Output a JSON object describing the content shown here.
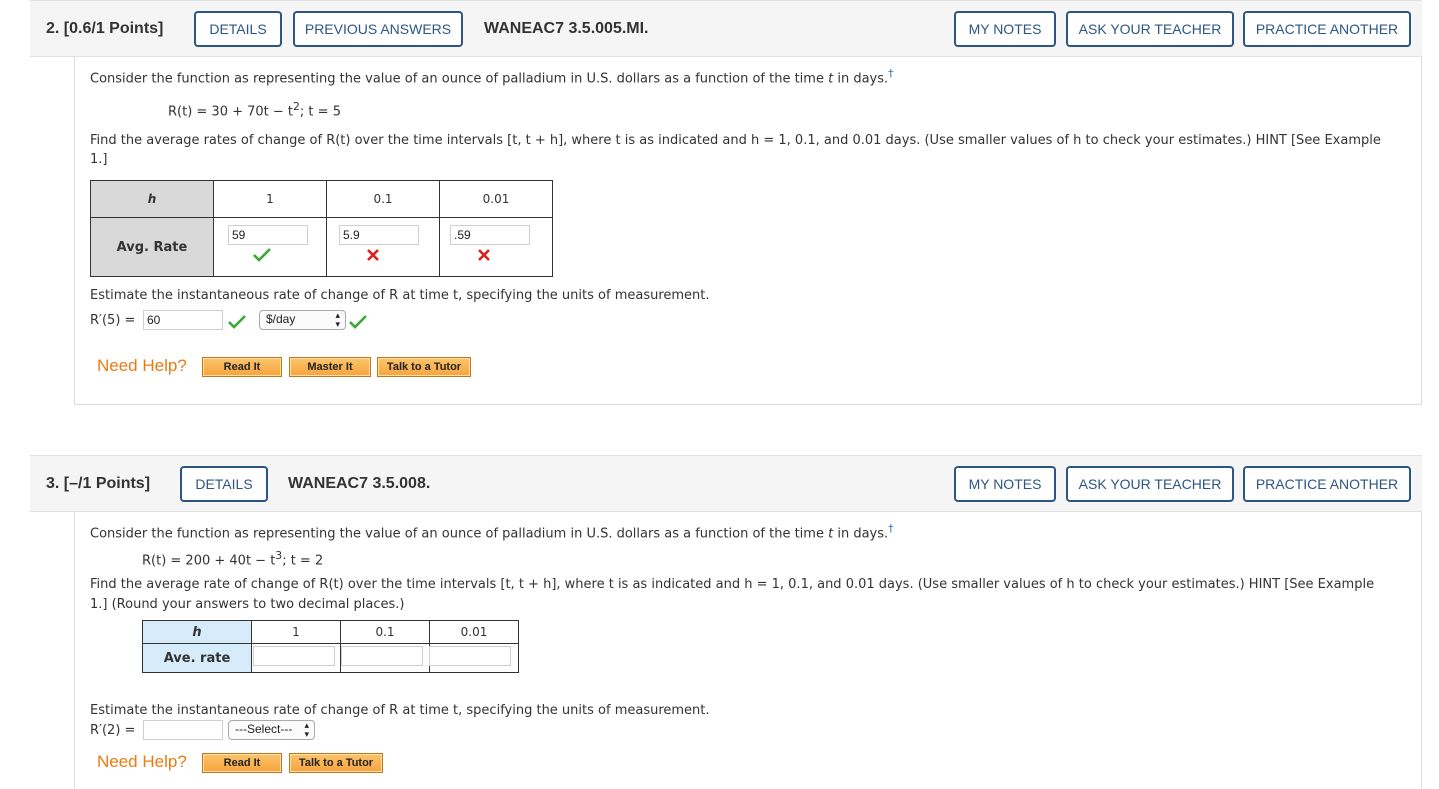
{
  "q2": {
    "number": "2.",
    "points": "[0.6/1 Points]",
    "details": "DETAILS",
    "previous_answers": "PREVIOUS ANSWERS",
    "code": "WANEAC7 3.5.005.MI.",
    "my_notes": "MY NOTES",
    "ask_teacher": "ASK YOUR TEACHER",
    "practice": "PRACTICE ANOTHER",
    "intro": "Consider the function as representing the value of an ounce of palladium in U.S. dollars as a function of the time ",
    "intro_var": "t",
    "intro_end": " in days.",
    "dagger": "†",
    "formula_a": "R(t) = 30 + 70t − t",
    "formula_exp": "2",
    "formula_b": "; t = 5",
    "find_line1": "Find the average rates of change of R(t) over the time intervals [t, t + h], where t is as indicated and h = 1, 0.1, and 0.01 days. (Use smaller values of h to check your estimates.) HINT [See Example",
    "find_line2": "1.]",
    "table_h": "h",
    "table_cols": [
      "1",
      "0.1",
      "0.01"
    ],
    "table_row": "Avg. Rate",
    "answers": [
      "59",
      "5.9",
      ".59"
    ],
    "estimate": "Estimate the instantaneous rate of change of R at time t, specifying the units of measurement.",
    "rprime": "R′(5) =",
    "rprime_value": "60",
    "units": "$/day",
    "need_help": "Need Help?",
    "read_it": "Read It",
    "master_it": "Master It",
    "tutor": "Talk to a Tutor"
  },
  "q3": {
    "number": "3.",
    "points": "[–/1 Points]",
    "details": "DETAILS",
    "code": "WANEAC7 3.5.008.",
    "my_notes": "MY NOTES",
    "ask_teacher": "ASK YOUR TEACHER",
    "practice": "PRACTICE ANOTHER",
    "intro": "Consider the function as representing the value of an ounce of palladium in U.S. dollars as a function of the time ",
    "intro_var": "t",
    "intro_end": " in days.",
    "dagger": "†",
    "formula_a": "R(t) = 200 + 40t − t",
    "formula_exp": "3",
    "formula_b": "; t = 2",
    "find_line1": "Find the average rate of change of R(t) over the time intervals [t, t + h], where t is as indicated and h = 1, 0.1, and 0.01 days. (Use smaller values of h to check your estimates.) HINT [See Example",
    "find_line2": "1.] (Round your answers to two decimal places.)",
    "table_h": "h",
    "table_cols": [
      "1",
      "0.1",
      "0.01"
    ],
    "table_row": "Ave. rate",
    "estimate": "Estimate the instantaneous rate of change of R at time t, specifying the units of measurement.",
    "rprime": "R′(2) =",
    "units_placeholder": "---Select---",
    "need_help": "Need Help?",
    "read_it": "Read It",
    "tutor": "Talk to a Tutor"
  },
  "colors": {
    "accent": "#2c5583",
    "help": "#ea7b12",
    "check": "#3aaa35",
    "cross": "#e02020",
    "table_header_blue": "#d6ecfa"
  },
  "icons": [
    "checkmark-icon",
    "cross-icon",
    "dagger-icon",
    "select-arrows-icon"
  ]
}
